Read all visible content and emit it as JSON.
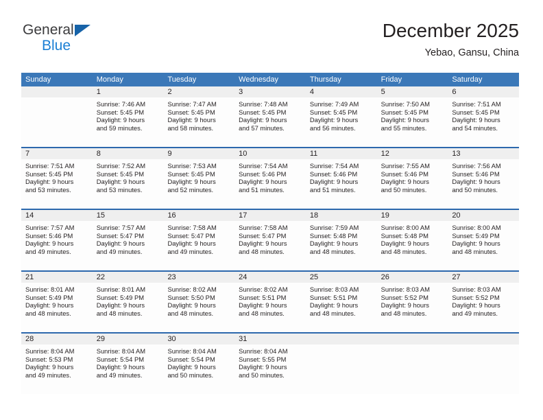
{
  "brand": {
    "name_top": "General",
    "name_bottom": "Blue",
    "triangle_color": "#1763a8",
    "blue_color": "#1b7fd4"
  },
  "header": {
    "title": "December 2025",
    "subtitle": "Yebao, Gansu, China"
  },
  "theme": {
    "header_row_bg": "#3b78b8",
    "week_divider": "#2c68ad",
    "day_band_bg": "#efefef",
    "text": "#231f20"
  },
  "weekdays": [
    "Sunday",
    "Monday",
    "Tuesday",
    "Wednesday",
    "Thursday",
    "Friday",
    "Saturday"
  ],
  "weeks": [
    [
      {
        "day": "",
        "sunrise": "",
        "sunset": "",
        "daylight1": "",
        "daylight2": "",
        "empty": true
      },
      {
        "day": "1",
        "sunrise": "Sunrise: 7:46 AM",
        "sunset": "Sunset: 5:45 PM",
        "daylight1": "Daylight: 9 hours",
        "daylight2": "and 59 minutes."
      },
      {
        "day": "2",
        "sunrise": "Sunrise: 7:47 AM",
        "sunset": "Sunset: 5:45 PM",
        "daylight1": "Daylight: 9 hours",
        "daylight2": "and 58 minutes."
      },
      {
        "day": "3",
        "sunrise": "Sunrise: 7:48 AM",
        "sunset": "Sunset: 5:45 PM",
        "daylight1": "Daylight: 9 hours",
        "daylight2": "and 57 minutes."
      },
      {
        "day": "4",
        "sunrise": "Sunrise: 7:49 AM",
        "sunset": "Sunset: 5:45 PM",
        "daylight1": "Daylight: 9 hours",
        "daylight2": "and 56 minutes."
      },
      {
        "day": "5",
        "sunrise": "Sunrise: 7:50 AM",
        "sunset": "Sunset: 5:45 PM",
        "daylight1": "Daylight: 9 hours",
        "daylight2": "and 55 minutes."
      },
      {
        "day": "6",
        "sunrise": "Sunrise: 7:51 AM",
        "sunset": "Sunset: 5:45 PM",
        "daylight1": "Daylight: 9 hours",
        "daylight2": "and 54 minutes."
      }
    ],
    [
      {
        "day": "7",
        "sunrise": "Sunrise: 7:51 AM",
        "sunset": "Sunset: 5:45 PM",
        "daylight1": "Daylight: 9 hours",
        "daylight2": "and 53 minutes."
      },
      {
        "day": "8",
        "sunrise": "Sunrise: 7:52 AM",
        "sunset": "Sunset: 5:45 PM",
        "daylight1": "Daylight: 9 hours",
        "daylight2": "and 53 minutes."
      },
      {
        "day": "9",
        "sunrise": "Sunrise: 7:53 AM",
        "sunset": "Sunset: 5:45 PM",
        "daylight1": "Daylight: 9 hours",
        "daylight2": "and 52 minutes."
      },
      {
        "day": "10",
        "sunrise": "Sunrise: 7:54 AM",
        "sunset": "Sunset: 5:46 PM",
        "daylight1": "Daylight: 9 hours",
        "daylight2": "and 51 minutes."
      },
      {
        "day": "11",
        "sunrise": "Sunrise: 7:54 AM",
        "sunset": "Sunset: 5:46 PM",
        "daylight1": "Daylight: 9 hours",
        "daylight2": "and 51 minutes."
      },
      {
        "day": "12",
        "sunrise": "Sunrise: 7:55 AM",
        "sunset": "Sunset: 5:46 PM",
        "daylight1": "Daylight: 9 hours",
        "daylight2": "and 50 minutes."
      },
      {
        "day": "13",
        "sunrise": "Sunrise: 7:56 AM",
        "sunset": "Sunset: 5:46 PM",
        "daylight1": "Daylight: 9 hours",
        "daylight2": "and 50 minutes."
      }
    ],
    [
      {
        "day": "14",
        "sunrise": "Sunrise: 7:57 AM",
        "sunset": "Sunset: 5:46 PM",
        "daylight1": "Daylight: 9 hours",
        "daylight2": "and 49 minutes."
      },
      {
        "day": "15",
        "sunrise": "Sunrise: 7:57 AM",
        "sunset": "Sunset: 5:47 PM",
        "daylight1": "Daylight: 9 hours",
        "daylight2": "and 49 minutes."
      },
      {
        "day": "16",
        "sunrise": "Sunrise: 7:58 AM",
        "sunset": "Sunset: 5:47 PM",
        "daylight1": "Daylight: 9 hours",
        "daylight2": "and 49 minutes."
      },
      {
        "day": "17",
        "sunrise": "Sunrise: 7:58 AM",
        "sunset": "Sunset: 5:47 PM",
        "daylight1": "Daylight: 9 hours",
        "daylight2": "and 48 minutes."
      },
      {
        "day": "18",
        "sunrise": "Sunrise: 7:59 AM",
        "sunset": "Sunset: 5:48 PM",
        "daylight1": "Daylight: 9 hours",
        "daylight2": "and 48 minutes."
      },
      {
        "day": "19",
        "sunrise": "Sunrise: 8:00 AM",
        "sunset": "Sunset: 5:48 PM",
        "daylight1": "Daylight: 9 hours",
        "daylight2": "and 48 minutes."
      },
      {
        "day": "20",
        "sunrise": "Sunrise: 8:00 AM",
        "sunset": "Sunset: 5:49 PM",
        "daylight1": "Daylight: 9 hours",
        "daylight2": "and 48 minutes."
      }
    ],
    [
      {
        "day": "21",
        "sunrise": "Sunrise: 8:01 AM",
        "sunset": "Sunset: 5:49 PM",
        "daylight1": "Daylight: 9 hours",
        "daylight2": "and 48 minutes."
      },
      {
        "day": "22",
        "sunrise": "Sunrise: 8:01 AM",
        "sunset": "Sunset: 5:49 PM",
        "daylight1": "Daylight: 9 hours",
        "daylight2": "and 48 minutes."
      },
      {
        "day": "23",
        "sunrise": "Sunrise: 8:02 AM",
        "sunset": "Sunset: 5:50 PM",
        "daylight1": "Daylight: 9 hours",
        "daylight2": "and 48 minutes."
      },
      {
        "day": "24",
        "sunrise": "Sunrise: 8:02 AM",
        "sunset": "Sunset: 5:51 PM",
        "daylight1": "Daylight: 9 hours",
        "daylight2": "and 48 minutes."
      },
      {
        "day": "25",
        "sunrise": "Sunrise: 8:03 AM",
        "sunset": "Sunset: 5:51 PM",
        "daylight1": "Daylight: 9 hours",
        "daylight2": "and 48 minutes."
      },
      {
        "day": "26",
        "sunrise": "Sunrise: 8:03 AM",
        "sunset": "Sunset: 5:52 PM",
        "daylight1": "Daylight: 9 hours",
        "daylight2": "and 48 minutes."
      },
      {
        "day": "27",
        "sunrise": "Sunrise: 8:03 AM",
        "sunset": "Sunset: 5:52 PM",
        "daylight1": "Daylight: 9 hours",
        "daylight2": "and 49 minutes."
      }
    ],
    [
      {
        "day": "28",
        "sunrise": "Sunrise: 8:04 AM",
        "sunset": "Sunset: 5:53 PM",
        "daylight1": "Daylight: 9 hours",
        "daylight2": "and 49 minutes."
      },
      {
        "day": "29",
        "sunrise": "Sunrise: 8:04 AM",
        "sunset": "Sunset: 5:54 PM",
        "daylight1": "Daylight: 9 hours",
        "daylight2": "and 49 minutes."
      },
      {
        "day": "30",
        "sunrise": "Sunrise: 8:04 AM",
        "sunset": "Sunset: 5:54 PM",
        "daylight1": "Daylight: 9 hours",
        "daylight2": "and 50 minutes."
      },
      {
        "day": "31",
        "sunrise": "Sunrise: 8:04 AM",
        "sunset": "Sunset: 5:55 PM",
        "daylight1": "Daylight: 9 hours",
        "daylight2": "and 50 minutes."
      },
      {
        "day": "",
        "sunrise": "",
        "sunset": "",
        "daylight1": "",
        "daylight2": "",
        "empty": true
      },
      {
        "day": "",
        "sunrise": "",
        "sunset": "",
        "daylight1": "",
        "daylight2": "",
        "empty": true
      },
      {
        "day": "",
        "sunrise": "",
        "sunset": "",
        "daylight1": "",
        "daylight2": "",
        "empty": true
      }
    ]
  ]
}
